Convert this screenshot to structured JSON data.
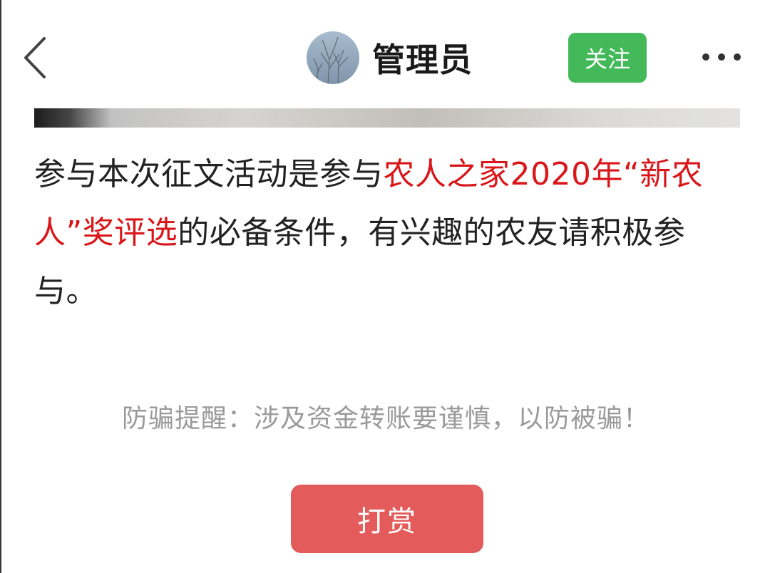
{
  "header": {
    "username": "管理员",
    "follow_label": "关注"
  },
  "article": {
    "part1": "参与本次征文活动是参与",
    "highlight": "农人之家2020年“新农人”奖评选",
    "part2": "的必备条件，有兴趣的农友请积极参与。"
  },
  "warning": "防骗提醒：涉及资金转账要谨慎，以防被骗！",
  "reward_label": "打赏",
  "colors": {
    "follow_green": "#43b95a",
    "highlight_red": "#d9161a",
    "reward_red": "#e45b5b",
    "warning_gray": "#9a9a9a"
  },
  "icons": {
    "back": "chevron-left-icon",
    "more": "more-dots-icon"
  }
}
